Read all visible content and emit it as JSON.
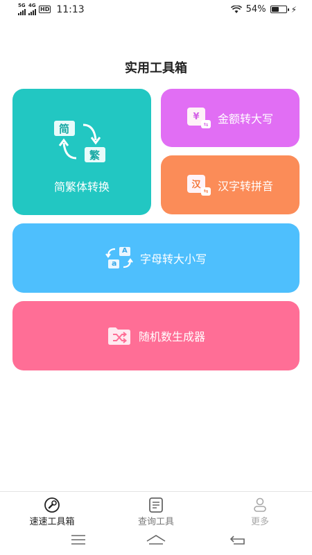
{
  "status_bar": {
    "network_1": "5G",
    "network_2": "4G",
    "hd": "HD",
    "time": "11:13",
    "battery_text": "54%",
    "battery_level": 0.54
  },
  "page": {
    "title": "实用工具箱"
  },
  "tools": {
    "simplified_traditional": {
      "label": "简繁体转换",
      "glyph_top": "简",
      "glyph_bottom": "繁",
      "color": "#22c7c2"
    },
    "amount_uppercase": {
      "label": "金额转大写",
      "glyph": "¥",
      "color": "#e16ef4"
    },
    "hanzi_pinyin": {
      "label": "汉字转拼音",
      "glyph": "汉",
      "color": "#fb8c58"
    },
    "letter_case": {
      "label": "字母转大小写",
      "glyph_upper": "A",
      "glyph_lower": "a",
      "color": "#4ebffd"
    },
    "random_number": {
      "label": "随机数生成器",
      "color": "#ff6e96"
    }
  },
  "tab_bar": {
    "home": {
      "label": "速速工具箱",
      "icon": "wrench-icon",
      "active": true
    },
    "query": {
      "label": "查询工具",
      "icon": "document-icon"
    },
    "more": {
      "label": "更多",
      "icon": "person-icon"
    }
  },
  "colors": {
    "active_tab": "#222222",
    "inactive_tab": "#777777",
    "disabled_tab": "#a8a8a8"
  }
}
